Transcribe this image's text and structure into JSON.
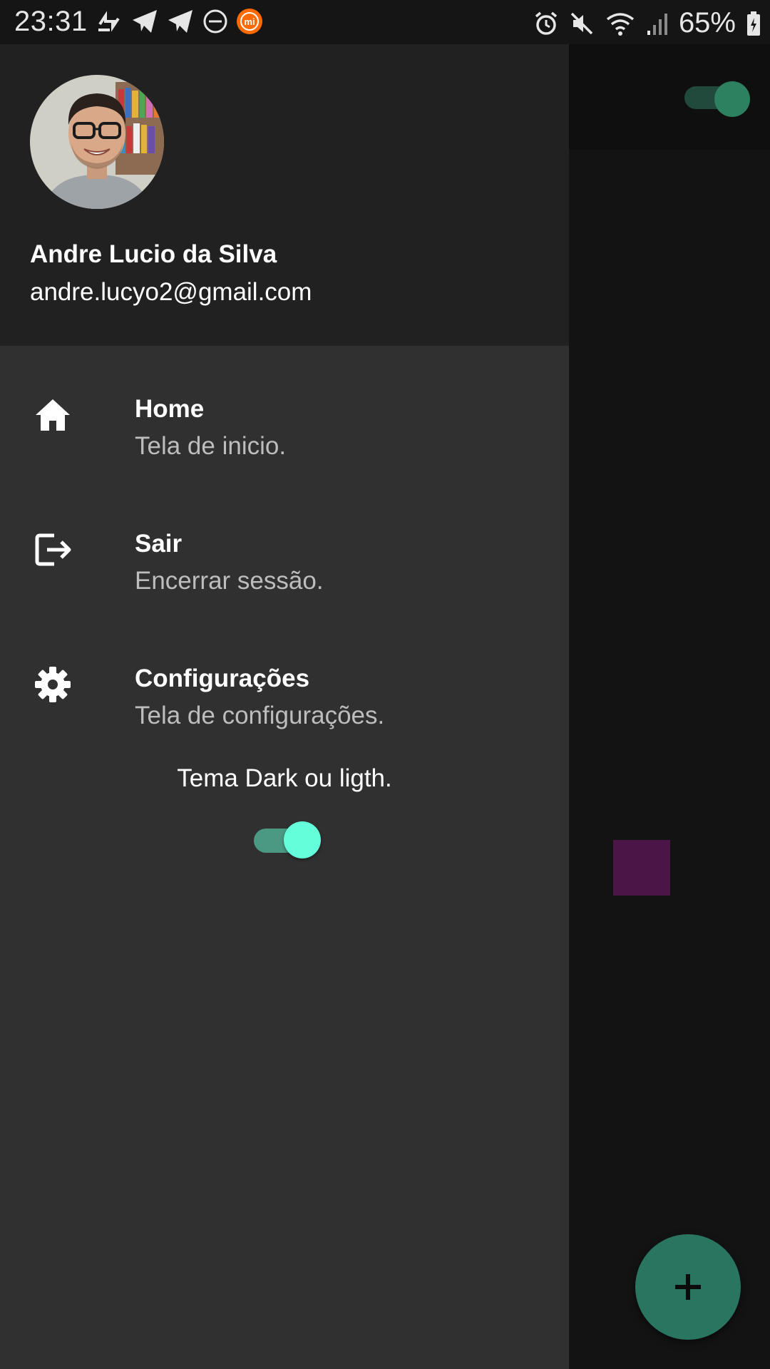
{
  "status_bar": {
    "time": "23:31",
    "battery": "65%",
    "left_icons": [
      "sync-arrows-icon",
      "telegram-icon",
      "telegram-icon",
      "do-not-disturb-icon",
      "mi-app-icon"
    ],
    "right_icons": [
      "alarm-icon",
      "mute-icon",
      "wifi-icon",
      "signal-icon",
      "battery-icon"
    ]
  },
  "drawer": {
    "user": {
      "name": "Andre Lucio da Silva",
      "email": "andre.lucyo2@gmail.com"
    },
    "items": [
      {
        "icon": "home-icon",
        "title": "Home",
        "subtitle": "Tela de inicio."
      },
      {
        "icon": "logout-icon",
        "title": "Sair",
        "subtitle": "Encerrar sessão."
      },
      {
        "icon": "gear-icon",
        "title": "Configurações",
        "subtitle": "Tela de configurações."
      }
    ],
    "theme": {
      "label": "Tema Dark ou ligth.",
      "enabled": true
    }
  },
  "background_app": {
    "toggle_enabled": true,
    "fab_icon": "plus-icon"
  },
  "colors": {
    "drawer_bg": "#303030",
    "header_bg": "#212121",
    "accent": "#64ffda",
    "fab": "#2a7560",
    "purple_box": "#4b1548"
  }
}
